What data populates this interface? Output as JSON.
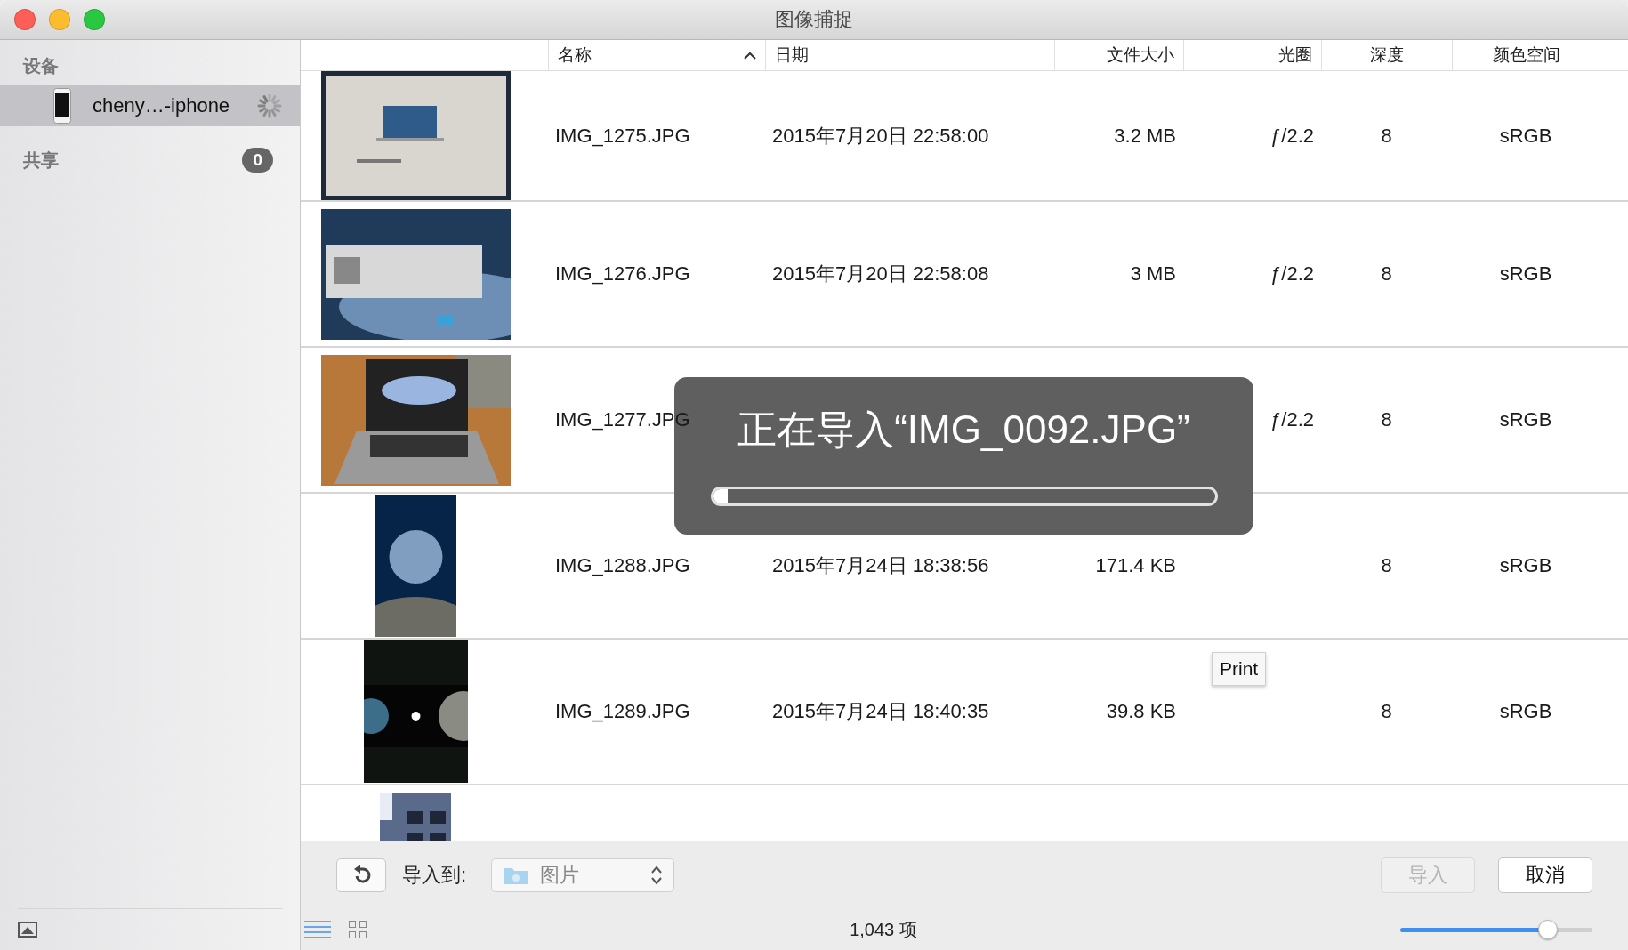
{
  "window": {
    "title": "图像捕捉"
  },
  "sidebar": {
    "sections": [
      {
        "title": "设备",
        "items": [
          {
            "label": "cheny…-iphone",
            "selected": true,
            "busy": true
          }
        ]
      },
      {
        "title": "共享",
        "badge": "0"
      }
    ]
  },
  "table": {
    "columns": [
      {
        "label": "名称",
        "sorted": true
      },
      {
        "label": "日期",
        "sorted": false
      },
      {
        "label": "文件大小",
        "sorted": false
      },
      {
        "label": "光圈",
        "sorted": false
      },
      {
        "label": "深度",
        "sorted": false
      },
      {
        "label": "颜色空间",
        "sorted": false
      }
    ],
    "rows": [
      {
        "thumbnail": {
          "kind": "picture"
        },
        "name": "IMG_1275.JPG",
        "date": "2015年7月20日 22:58:00",
        "size": "3.2 MB",
        "aperture": "ƒ/2.2",
        "depth": "8",
        "color_space": "sRGB"
      },
      {
        "thumbnail": {
          "kind": "picture"
        },
        "name": "IMG_1276.JPG",
        "date": "2015年7月20日 22:58:08",
        "size": "3 MB",
        "aperture": "ƒ/2.2",
        "depth": "8",
        "color_space": "sRGB"
      },
      {
        "thumbnail": {
          "kind": "picture"
        },
        "name": "IMG_1277.JPG",
        "aperture": "ƒ/2.2",
        "depth": "8",
        "color_space": "sRGB"
      },
      {
        "thumbnail": {
          "kind": "picture"
        },
        "name": "IMG_1288.JPG",
        "date": "2015年7月24日 18:38:56",
        "size": "171.4 KB",
        "depth": "8",
        "color_space": "sRGB"
      },
      {
        "thumbnail": {
          "kind": "picture"
        },
        "name": "IMG_1289.JPG",
        "date": "2015年7月24日 18:40:35",
        "size": "39.8 KB",
        "depth": "8",
        "color_space": "sRGB"
      },
      {
        "thumbnail": {
          "kind": "picture"
        }
      }
    ]
  },
  "tooltip": "Print",
  "progress": {
    "message": "正在导入“IMG_0092.JPG”",
    "level": 0.03
  },
  "toolbar": {
    "import_to_label": "导入到:",
    "destination": "图片",
    "import_button": {
      "label": "导入",
      "disabled": true
    },
    "cancel_button": "取消"
  },
  "status_bar": {
    "view_modes": [
      {
        "kind": "list",
        "selected": true
      },
      {
        "kind": "grid",
        "selected": false
      }
    ],
    "count": "1,043 项",
    "zoom": {
      "level": 0.77
    }
  }
}
